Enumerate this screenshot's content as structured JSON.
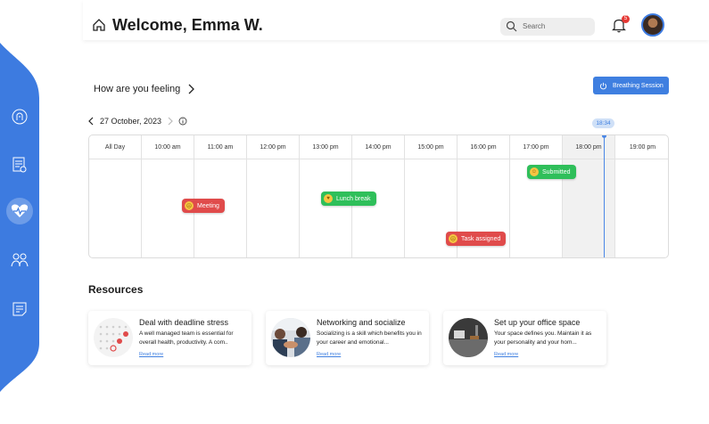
{
  "header": {
    "title": "Welcome, Emma W.",
    "search_placeholder": "Search",
    "notification_count": "5"
  },
  "sidebar": {
    "items": [
      {
        "icon": "brain-icon",
        "active": false
      },
      {
        "icon": "certificate-icon",
        "active": false
      },
      {
        "icon": "heart-pulse-icon",
        "active": true
      },
      {
        "icon": "people-icon",
        "active": false
      },
      {
        "icon": "notes-icon",
        "active": false
      }
    ],
    "color": "#3d7be0"
  },
  "feeling": {
    "label": "How are you feeling",
    "breathing_button": "Breathing Session"
  },
  "calendar": {
    "date": "27 October, 2023",
    "now_label": "18:34",
    "columns": [
      "All Day",
      "10:00 am",
      "11:00 am",
      "12:00 pm",
      "13:00 pm",
      "14:00 pm",
      "15:00 pm",
      "16:00 pm",
      "17:00 pm",
      "18:00 pm",
      "19:00 pm"
    ],
    "events": [
      {
        "label": "Meeting",
        "color": "red",
        "emoji": "sad"
      },
      {
        "label": "Lunch break",
        "color": "green",
        "emoji": "love"
      },
      {
        "label": "Task assigned",
        "color": "red",
        "emoji": "sad"
      },
      {
        "label": "Submitted",
        "color": "green",
        "emoji": "happy"
      }
    ]
  },
  "resources": {
    "title": "Resources",
    "read_more": "Read more",
    "cards": [
      {
        "title": "Deal with deadline stress",
        "desc": "A well managed team is essential for overall health, productivity. A com..",
        "thumb": "calendar-photo"
      },
      {
        "title": "Networking and socialize",
        "desc": "Socializing is a skill which benefits you in your career and emotional...",
        "thumb": "handshake-photo"
      },
      {
        "title": "Set up your office space",
        "desc": "Your space defines you. Maintain it as your personality and your hom...",
        "thumb": "desk-photo"
      }
    ]
  }
}
